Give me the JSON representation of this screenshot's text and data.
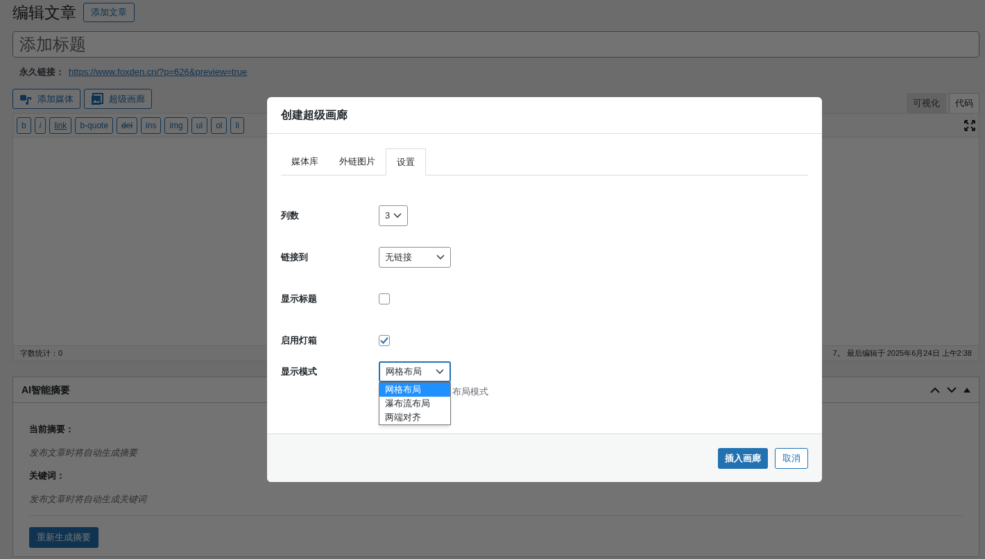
{
  "page": {
    "heading": "编辑文章",
    "add_button": "添加文章",
    "title_placeholder": "添加标题",
    "permalink_label": "永久链接：",
    "permalink_url": "https://www.foxden.cn/?p=626&preview=true"
  },
  "media_buttons": [
    {
      "label": "添加媒体",
      "kind": "media"
    },
    {
      "label": "超级画廊",
      "kind": "gallery"
    }
  ],
  "editor_tabs": [
    {
      "label": "可视化",
      "selected": false
    },
    {
      "label": "代码",
      "selected": true
    }
  ],
  "quicktags": [
    {
      "label": "b",
      "kind": "plain"
    },
    {
      "label": "i",
      "kind": "italic"
    },
    {
      "label": "link",
      "kind": "underline"
    },
    {
      "label": "b-quote",
      "kind": "plain"
    },
    {
      "label": "del",
      "kind": "strike"
    },
    {
      "label": "ins",
      "kind": "plain"
    },
    {
      "label": "img",
      "kind": "plain"
    },
    {
      "label": "ul",
      "kind": "plain"
    },
    {
      "label": "ol",
      "kind": "plain"
    },
    {
      "label": "li",
      "kind": "plain"
    }
  ],
  "status_bar": {
    "word_count": "字数统计：0",
    "last_edited": "7。 最后编辑于 2025年6月24日 上午2:38"
  },
  "summary_panel": {
    "title": "AI智能摘要",
    "summary_label": "当前摘要：",
    "summary_text": "发布文章时将自动生成摘要",
    "keywords_label": "关键词：",
    "keywords_text": "发布文章时将自动生成关键词",
    "regenerate_button": "重新生成摘要"
  },
  "dialog": {
    "title": "创建超级画廊",
    "tabs": [
      {
        "label": "媒体库",
        "selected": false
      },
      {
        "label": "外链图片",
        "selected": false
      },
      {
        "label": "设置",
        "selected": true
      }
    ],
    "settings": [
      {
        "label": "列数",
        "kind": "select",
        "value": "3",
        "expanded": false
      },
      {
        "label": "链接到",
        "kind": "select",
        "value": "无链接",
        "expanded": false
      },
      {
        "label": "显示标题",
        "kind": "checkbox",
        "checked": false
      },
      {
        "label": "启用灯箱",
        "kind": "checkbox",
        "checked": true
      },
      {
        "label": "显示模式",
        "kind": "select",
        "value": "网格布局",
        "expanded": true,
        "hint": "布局模式",
        "options": [
          {
            "label": "网格布局",
            "selected": true
          },
          {
            "label": "瀑布流布局",
            "selected": false
          },
          {
            "label": "两端对齐",
            "selected": false
          }
        ]
      }
    ],
    "buttons": [
      {
        "label": "插入画廊",
        "kind": "primary"
      },
      {
        "label": "取消",
        "kind": "secondary"
      }
    ]
  }
}
